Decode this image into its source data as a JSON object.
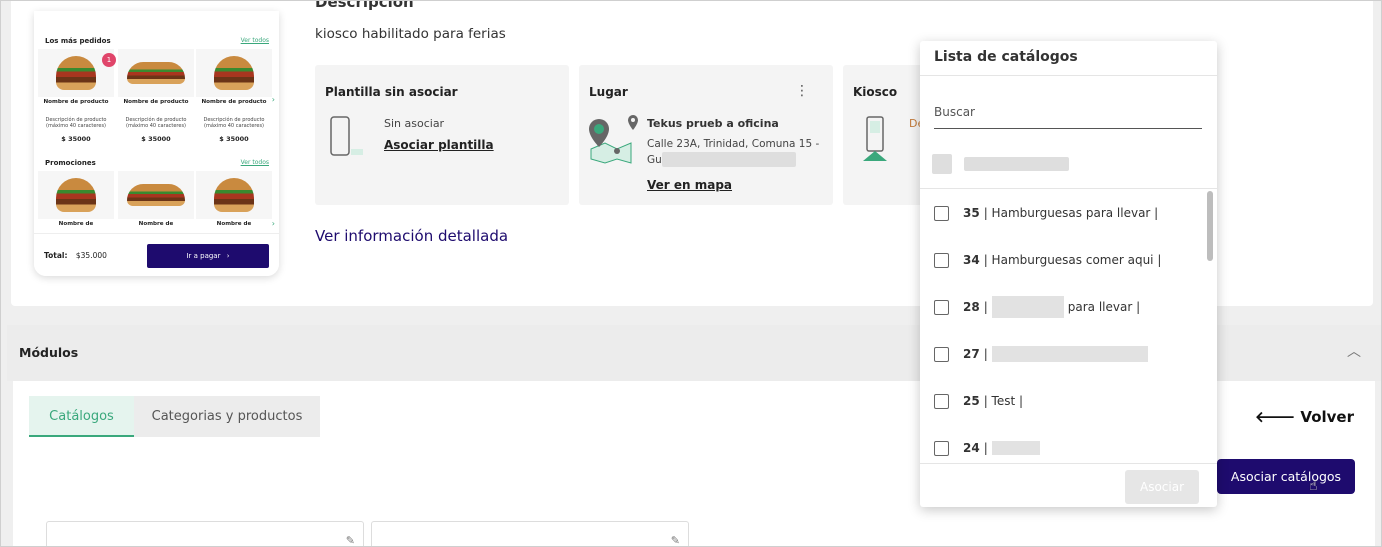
{
  "preview": {
    "most_ordered_title": "Los más pedidos",
    "promotions_title": "Promociones",
    "see_all": "Ver todos",
    "badge_count": "1",
    "product_name": "Nombre de producto",
    "product_name_short": "Nombre de",
    "product_desc": "Descripción de producto (máximo 40 caracteres)",
    "product_price": "$ 35000",
    "total_label": "Total:",
    "total_value": "$35.000",
    "pay_button": "Ir a pagar",
    "arrow": "›"
  },
  "description": {
    "title": "Descripción",
    "text": "kiosco habilitado para ferias"
  },
  "cards": {
    "template": {
      "title": "Plantilla sin asociar",
      "status": "Sin asociar",
      "link": "Asociar plantilla"
    },
    "place": {
      "title": "Lugar",
      "name": "Tekus prueb a oficina",
      "address_line1": "Calle 23A, Trinidad, Comuna 15 -",
      "address_line2": "Gu",
      "link": "Ver en mapa",
      "menu_icon": "⋮"
    },
    "kiosk": {
      "title": "Kiosco",
      "text_start": "De"
    }
  },
  "see_details": "Ver información detallada",
  "modules": {
    "title": "Módulos",
    "caret": "︿",
    "tabs": [
      {
        "label": "Catálogos"
      },
      {
        "label": "Categorias y productos"
      }
    ],
    "back_label": "🡐 Volver",
    "associate_button": "Asociar catálogos"
  },
  "catalog_dropdown": {
    "title": "Lista de catálogos",
    "search_placeholder": "Buscar",
    "items": [
      {
        "id": "35",
        "name": "| Hamburguesas para llevar |"
      },
      {
        "id": "34",
        "name": "| Hamburguesas comer aqui |"
      },
      {
        "id": "28",
        "name": "| ",
        "name_tail": "para llevar |"
      },
      {
        "id": "27",
        "name": "|"
      },
      {
        "id": "25",
        "name": "| Test |"
      },
      {
        "id": "24",
        "name": "|"
      }
    ],
    "associate_button": "Asociar"
  },
  "colors": {
    "primary": "#1e0b6e",
    "accent_green": "#3aa87c",
    "badge_pink": "#e0456a"
  }
}
